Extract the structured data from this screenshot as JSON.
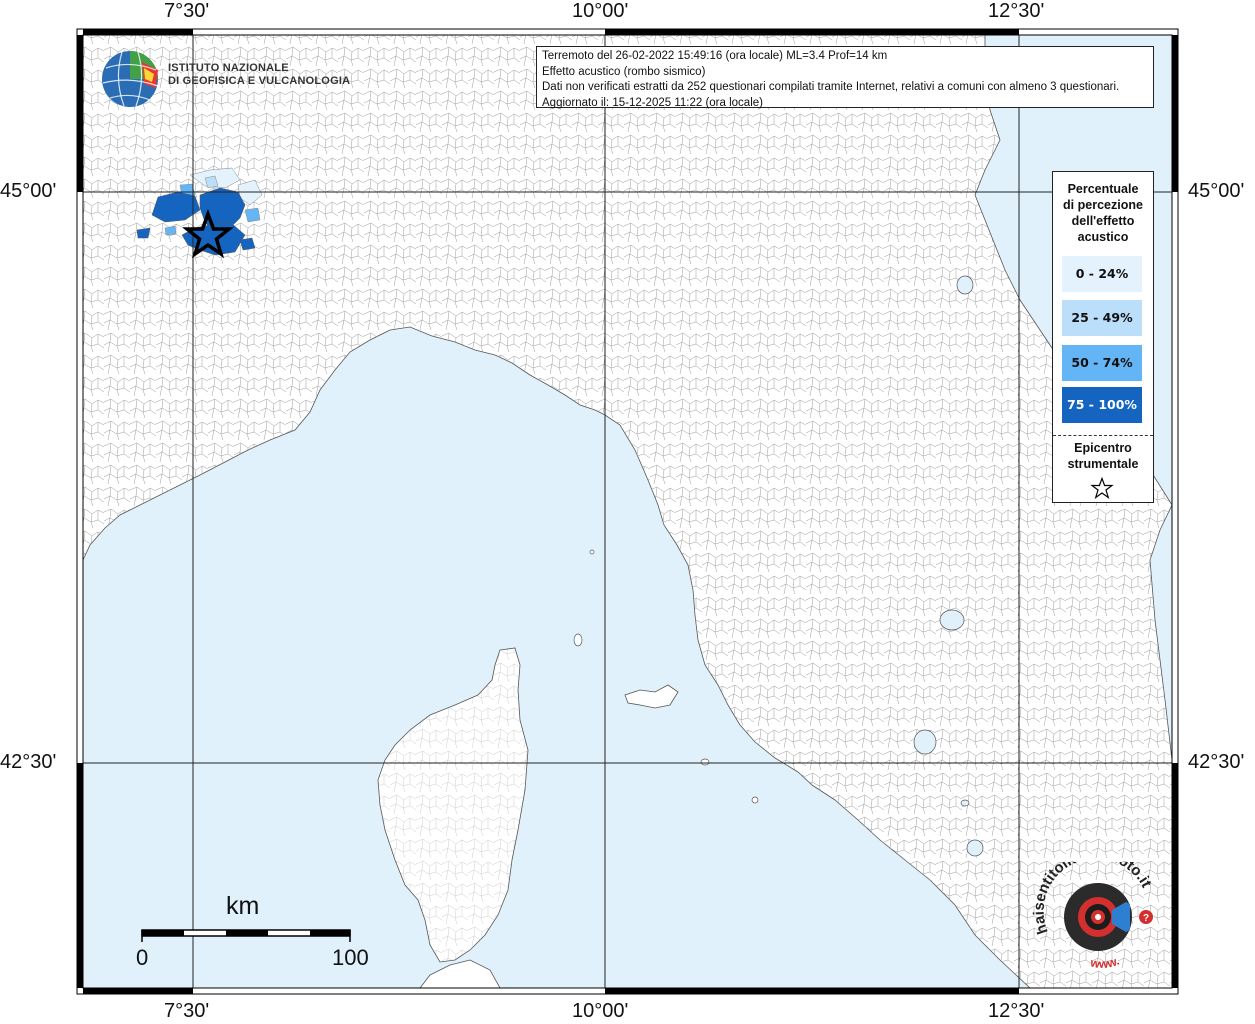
{
  "map": {
    "axis_labels": {
      "top": [
        "7°30'",
        "10°00'",
        "12°30'"
      ],
      "bottom": [
        "7°30'",
        "10°00'",
        "12°30'"
      ],
      "left": [
        "45°00'",
        "42°30'"
      ],
      "right": [
        "45°00'",
        "42°30'"
      ]
    },
    "colors": {
      "sea": "#e0f1fc",
      "land": "#ffffff",
      "border": "#888888",
      "class_0_24": "#e3f2fd",
      "class_25_49": "#bbdefb",
      "class_50_74": "#64b5f6",
      "class_75_100": "#1565c0"
    },
    "epicenter_icon": "star-icon"
  },
  "info": {
    "line1": "Terremoto del 26-02-2022 15:49:16 (ora locale) ML=3.4 Prof=14 km",
    "line2": "Effetto acustico (rombo sismico)",
    "line3": "Dati non verificati estratti da 252 questionari compilati tramite Internet, relativi a comuni con almeno 3 questionari.",
    "line4": "Aggiornato il: 15-12-2025 11:22 (ora locale)"
  },
  "logo": {
    "line1": "ISTITUTO NAZIONALE",
    "line2": "DI GEOFISICA E VULCANOLOGIA"
  },
  "legend": {
    "title1": "Percentuale",
    "title2": "di percezione",
    "title3": "dell'effetto",
    "title4": "acustico",
    "items": [
      "0 - 24%",
      "25 - 49%",
      "50 - 74%",
      "75 - 100%"
    ],
    "epicentro1": "Epicentro",
    "epicentro2": "strumentale"
  },
  "scale": {
    "unit": "km",
    "min": "0",
    "max": "100"
  },
  "badge": {
    "text": "haisentitoilterremoto.it?",
    "url_text": "www."
  }
}
